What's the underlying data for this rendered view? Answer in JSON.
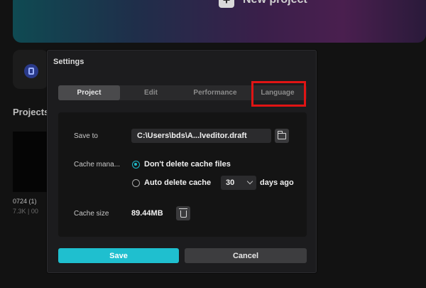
{
  "background": {
    "new_project_label": "New project",
    "projects_label": "Projects",
    "project_name": "0724 (1)",
    "project_meta": "7.3K | 00"
  },
  "dialog": {
    "title": "Settings",
    "tabs": [
      {
        "label": "Project",
        "active": true
      },
      {
        "label": "Edit",
        "active": false
      },
      {
        "label": "Performance",
        "active": false
      },
      {
        "label": "Language",
        "active": false
      }
    ],
    "save_to": {
      "label": "Save to",
      "path": "C:\\Users\\bds\\A...lveditor.draft",
      "icon": "folder-icon"
    },
    "cache_management": {
      "label": "Cache mana...",
      "options": [
        {
          "label": "Don't delete cache files",
          "selected": true
        },
        {
          "label": "Auto delete cache",
          "selected": false
        }
      ],
      "days_value": "30",
      "days_suffix": "days ago"
    },
    "cache_size": {
      "label": "Cache size",
      "value": "89.44MB",
      "icon": "trash-icon"
    },
    "buttons": {
      "save": "Save",
      "cancel": "Cancel"
    }
  },
  "colors": {
    "accent": "#1fbfcf",
    "highlight_box": "#e01414"
  }
}
